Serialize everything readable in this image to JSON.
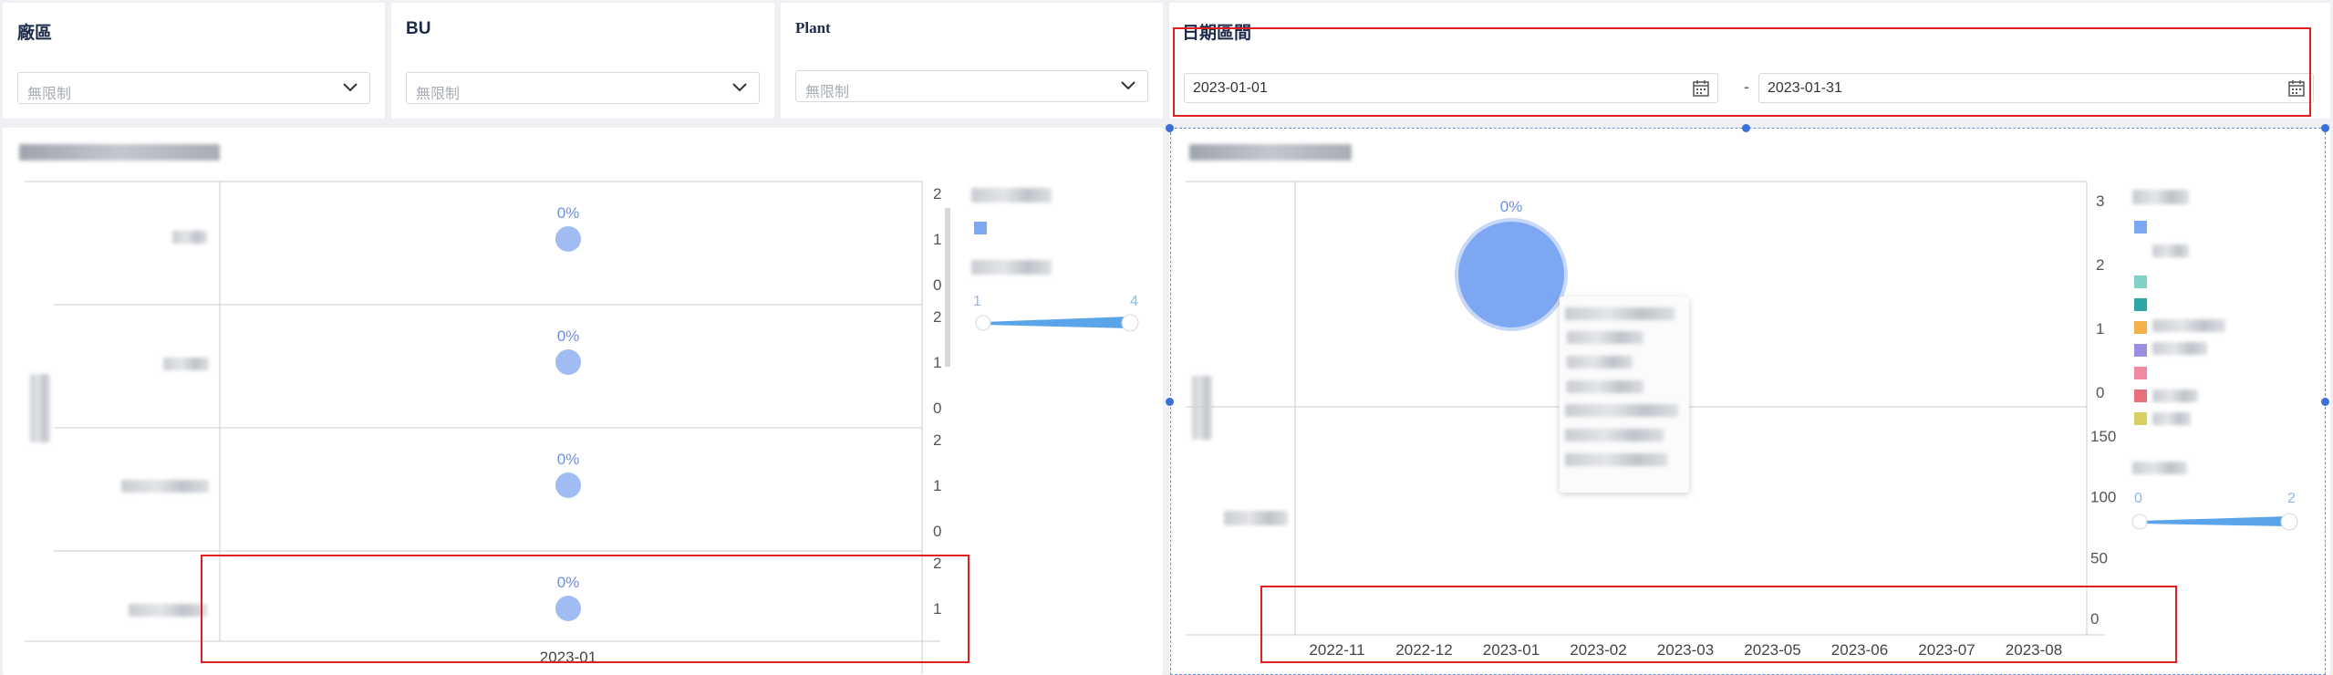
{
  "filters": {
    "plant_area": {
      "title": "廠區",
      "placeholder": "無限制"
    },
    "bu": {
      "title": "BU",
      "placeholder": "無限制"
    },
    "plant": {
      "title": "Plant",
      "placeholder": "無限制"
    },
    "date_range": {
      "title": "日期區間",
      "start": "2023-01-01",
      "separator": "-",
      "end": "2023-01-31"
    }
  },
  "colors": {
    "accent": "#7da7f2",
    "bubble": "#8fb0f0",
    "highlight_box": "#e02020",
    "slider": "#5aa4ea"
  },
  "left_chart": {
    "legend_slider": {
      "min": "1",
      "max": "4"
    },
    "chart_data": {
      "type": "scatter",
      "x_tick": "2023-01",
      "panels": [
        {
          "y_ticks": [
            "2",
            "1",
            "0"
          ],
          "points": [
            {
              "x": "2023-01",
              "y": 1,
              "label": "0%"
            }
          ]
        },
        {
          "y_ticks": [
            "2",
            "1",
            "0"
          ],
          "points": [
            {
              "x": "2023-01",
              "y": 1,
              "label": "0%"
            }
          ]
        },
        {
          "y_ticks": [
            "2",
            "1",
            "0"
          ],
          "points": [
            {
              "x": "2023-01",
              "y": 1,
              "label": "0%"
            }
          ]
        },
        {
          "y_ticks": [
            "2",
            "1"
          ],
          "points": [
            {
              "x": "2023-01",
              "y": 1,
              "label": "0%"
            }
          ]
        }
      ]
    }
  },
  "right_chart": {
    "legend_slider": {
      "min": "0",
      "max": "2"
    },
    "chart_data": {
      "type": "scatter",
      "x_ticks": [
        "2022-11",
        "2022-12",
        "2023-01",
        "2023-02",
        "2023-03",
        "2023-05",
        "2023-06",
        "2023-07",
        "2023-08"
      ],
      "upper_y_ticks": [
        "3",
        "2",
        "1",
        "0"
      ],
      "lower_y_ticks": [
        "150",
        "100",
        "50",
        "0"
      ],
      "points": [
        {
          "x": "2023-01",
          "y": 2,
          "label": "0%"
        }
      ]
    }
  }
}
